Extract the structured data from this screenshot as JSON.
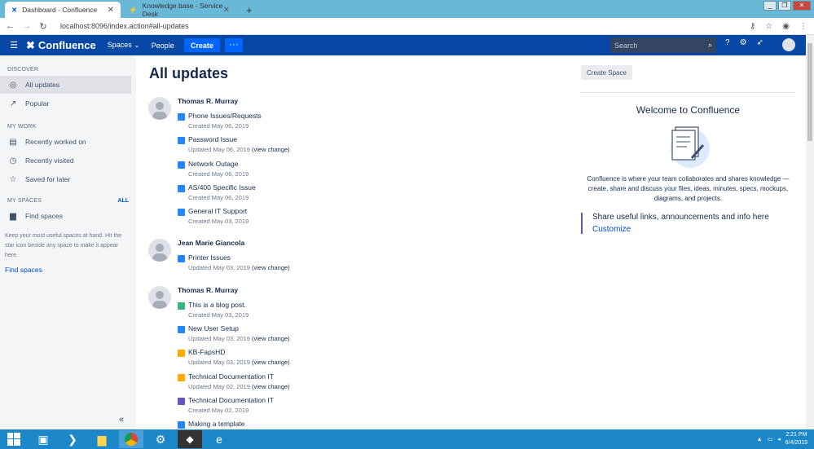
{
  "browser": {
    "tabs": [
      {
        "title": "Dashboard - Confluence",
        "active": true
      },
      {
        "title": "Knowledge base - Service Desk",
        "active": false
      }
    ],
    "url": "localhost:8096/index.action#all-updates"
  },
  "topbar": {
    "logo_text": "Confluence",
    "spaces_label": "Spaces",
    "people_label": "People",
    "create_label": "Create",
    "search_placeholder": "Search",
    "brand_color": "#0747a6"
  },
  "sidebar": {
    "discover_heading": "DISCOVER",
    "discover_items": [
      {
        "label": "All updates",
        "icon": "compass-icon"
      },
      {
        "label": "Popular",
        "icon": "trending-icon"
      }
    ],
    "mywork_heading": "MY WORK",
    "mywork_items": [
      {
        "label": "Recently worked on",
        "icon": "document-icon"
      },
      {
        "label": "Recently visited",
        "icon": "clock-icon"
      },
      {
        "label": "Saved for later",
        "icon": "star-icon"
      }
    ],
    "myspaces_heading": "MY SPACES",
    "myspaces_all": "ALL",
    "find_spaces_item": "Find spaces",
    "note": "Keep your most useful spaces at hand. Hit the star icon beside any space to make it appear here.",
    "find_spaces_link": "Find spaces"
  },
  "main": {
    "title": "All updates",
    "create_space_label": "Create Space",
    "welcome_title": "Welcome to Confluence",
    "welcome_desc": "Confluence is where your team collaborates and shares knowledge — create, share and discuss your files, ideas, minutes, specs, mockups, diagrams, and projects.",
    "share_text": "Share useful links, announcements and info here",
    "customize_label": "Customize",
    "groups": [
      {
        "author": "Thomas R. Murray",
        "entries": [
          {
            "title": "Phone Issues/Requests",
            "meta": "Created May 06, 2019",
            "change": "",
            "icon": "page-icon"
          },
          {
            "title": "Password Issue",
            "meta": "Updated May 06, 2019",
            "change": "(view change)",
            "icon": "page-icon"
          },
          {
            "title": "Network Outage",
            "meta": "Created May 06, 2019",
            "change": "",
            "icon": "page-icon"
          },
          {
            "title": "AS/400 Specific Issue",
            "meta": "Created May 06, 2019",
            "change": "",
            "icon": "page-icon"
          },
          {
            "title": "General IT Support",
            "meta": "Created May 03, 2019",
            "change": "",
            "icon": "page-icon"
          }
        ]
      },
      {
        "author": "Jean Marie Giancola",
        "entries": [
          {
            "title": "Printer Issues",
            "meta": "Updated May 03, 2019",
            "change": "(view change)",
            "icon": "page-icon"
          }
        ]
      },
      {
        "author": "Thomas R. Murray",
        "entries": [
          {
            "title": "This is a blog post.",
            "meta": "Created May 03, 2019",
            "change": "",
            "icon": "blog-icon"
          },
          {
            "title": "New User Setup",
            "meta": "Updated May 03, 2019",
            "change": "(view change)",
            "icon": "page-icon"
          },
          {
            "title": "KB-FapsHD",
            "meta": "Updated May 03, 2019",
            "change": "(view change)",
            "icon": "space-icon"
          },
          {
            "title": "Technical Documentation IT",
            "meta": "Updated May 02, 2019",
            "change": "(view change)",
            "icon": "space-icon"
          },
          {
            "title": "Technical Documentation IT",
            "meta": "Created May 02, 2019",
            "change": "",
            "icon": "space-purple-icon"
          },
          {
            "title": "Making a template",
            "meta": "",
            "change": "",
            "icon": "page-icon"
          }
        ]
      }
    ]
  },
  "taskbar": {
    "time": "2:21 PM",
    "date": "6/4/2019"
  }
}
